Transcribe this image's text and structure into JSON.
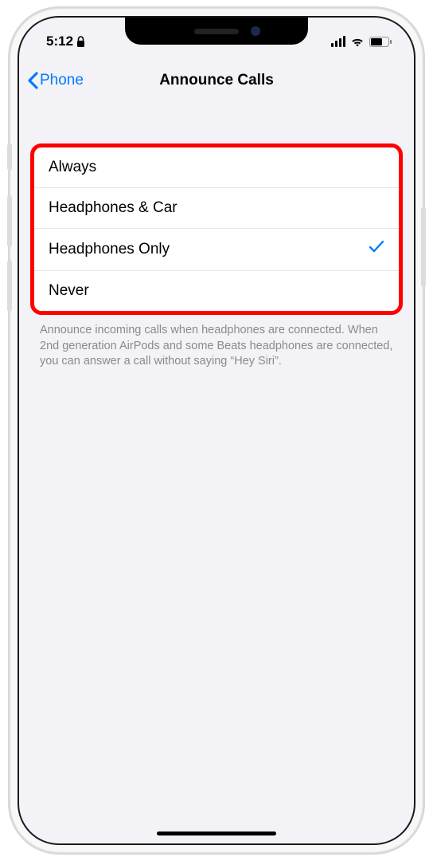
{
  "status": {
    "time": "5:12",
    "lock_glyph": "⬛"
  },
  "nav": {
    "back_label": "Phone",
    "title": "Announce Calls"
  },
  "options": [
    {
      "label": "Always",
      "selected": false
    },
    {
      "label": "Headphones & Car",
      "selected": false
    },
    {
      "label": "Headphones Only",
      "selected": true
    },
    {
      "label": "Never",
      "selected": false
    }
  ],
  "footer": "Announce incoming calls when headphones are connected. When 2nd generation AirPods and some Beats headphones are connected, you can answer a call without saying “Hey Siri”.",
  "colors": {
    "accent": "#007aff",
    "highlight_ring": "#ff0000",
    "bg": "#f2f2f7"
  }
}
